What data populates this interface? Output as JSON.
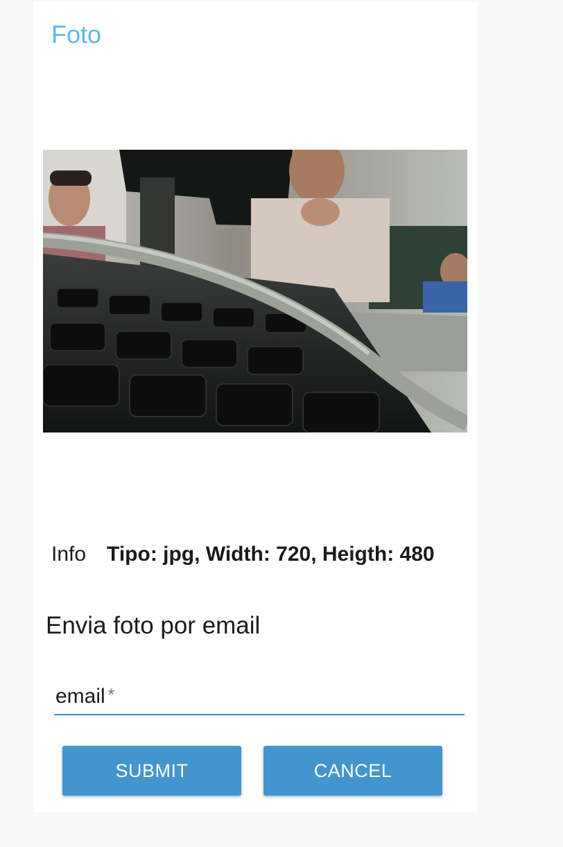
{
  "header": {
    "title": "Foto"
  },
  "photo": {
    "alt": "Foto"
  },
  "info": {
    "label": "Info",
    "value": "Tipo: jpg, Width: 720, Heigth: 480"
  },
  "email_section": {
    "title": "Envia foto por email",
    "email_label": "email",
    "required_mark": "*",
    "email_value": ""
  },
  "actions": {
    "submit_label": "SUBMIT",
    "cancel_label": "CANCEL"
  },
  "colors": {
    "accent": "#5bb8ec",
    "button": "#4396cd",
    "underline": "#4191cb"
  }
}
